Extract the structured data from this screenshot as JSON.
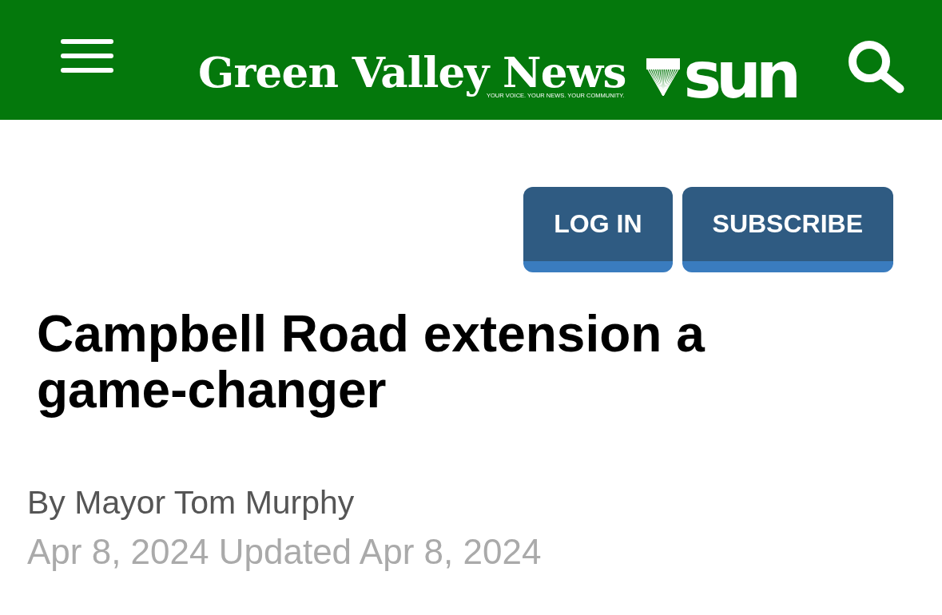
{
  "header": {
    "logo": {
      "title": "Green Valley News",
      "tagline": "YOUR VOICE. YOUR NEWS. YOUR COMMUNITY.",
      "partner": "sun"
    }
  },
  "account_buttons": [
    {
      "label": "LOG IN"
    },
    {
      "label": "SUBSCRIBE"
    }
  ],
  "article": {
    "headline": "Campbell Road extension a game-changer",
    "byline": "By Mayor Tom Murphy",
    "dateline": "Apr 8, 2024 Updated Apr 8, 2024"
  }
}
